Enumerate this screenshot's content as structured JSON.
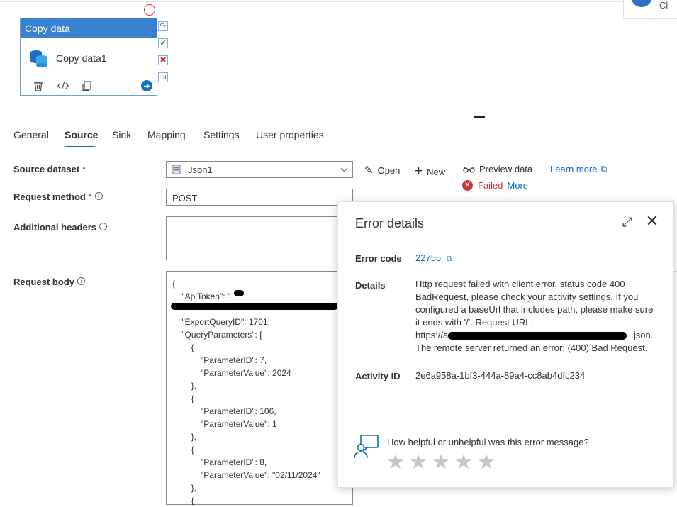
{
  "canvas": {
    "activity": {
      "header": "Copy data",
      "name": "Copy data1"
    },
    "corner_text": "Cl"
  },
  "tabs": [
    {
      "label": "General",
      "active": false
    },
    {
      "label": "Source",
      "active": true
    },
    {
      "label": "Sink",
      "active": false
    },
    {
      "label": "Mapping",
      "active": false
    },
    {
      "label": "Settings",
      "active": false
    },
    {
      "label": "User properties",
      "active": false
    }
  ],
  "form": {
    "source_dataset_label": "Source dataset",
    "source_dataset_value": "Json1",
    "request_method_label": "Request method",
    "request_method_value": "POST",
    "additional_headers_label": "Additional headers",
    "request_body_label": "Request body",
    "required_mark": "*",
    "info_glyph": "i",
    "request_body_lines": [
      "{",
      "    \"ApiToken\": \"",
      "",
      "    \"ExportQueryID\": 1701,",
      "    \"QueryParameters\": [",
      "        {",
      "            \"ParameterID\": 7,",
      "            \"ParameterValue\": 2024",
      "        },",
      "        {",
      "            \"ParameterID\": 106,",
      "            \"ParameterValue\": 1",
      "        },",
      "        {",
      "            \"ParameterID\": 8,",
      "            \"ParameterValue\": \"02/11/2024\"",
      "        },",
      "        {"
    ]
  },
  "toolbar": {
    "open_label": "Open",
    "new_label": "New",
    "preview_label": "Preview data",
    "learn_more_label": "Learn more",
    "status_label": "Failed",
    "more_label": "More"
  },
  "error_panel": {
    "title": "Error details",
    "error_code_label": "Error code",
    "error_code_value": "22755",
    "details_label": "Details",
    "details_lines": [
      "Http request failed with client error, status code 400",
      "BadRequest, please check your activity settings. If you",
      "configured a baseUrl that includes path, please make sure",
      "it ends with '/'. Request URL:",
      "https://a",
      "The remote server returned an error: (400) Bad Request."
    ],
    "details_url_suffix": ".json.",
    "activity_id_label": "Activity ID",
    "activity_id_value": "2e6a958a-1bf3-444a-89a4-cc8ab4dfc234",
    "feedback_question": "How helpful or unhelpful was this error message?",
    "star_count": 5
  },
  "colors": {
    "accent": "#0f6cbd",
    "activity_header": "#3a80d0",
    "error": "#d13438"
  }
}
